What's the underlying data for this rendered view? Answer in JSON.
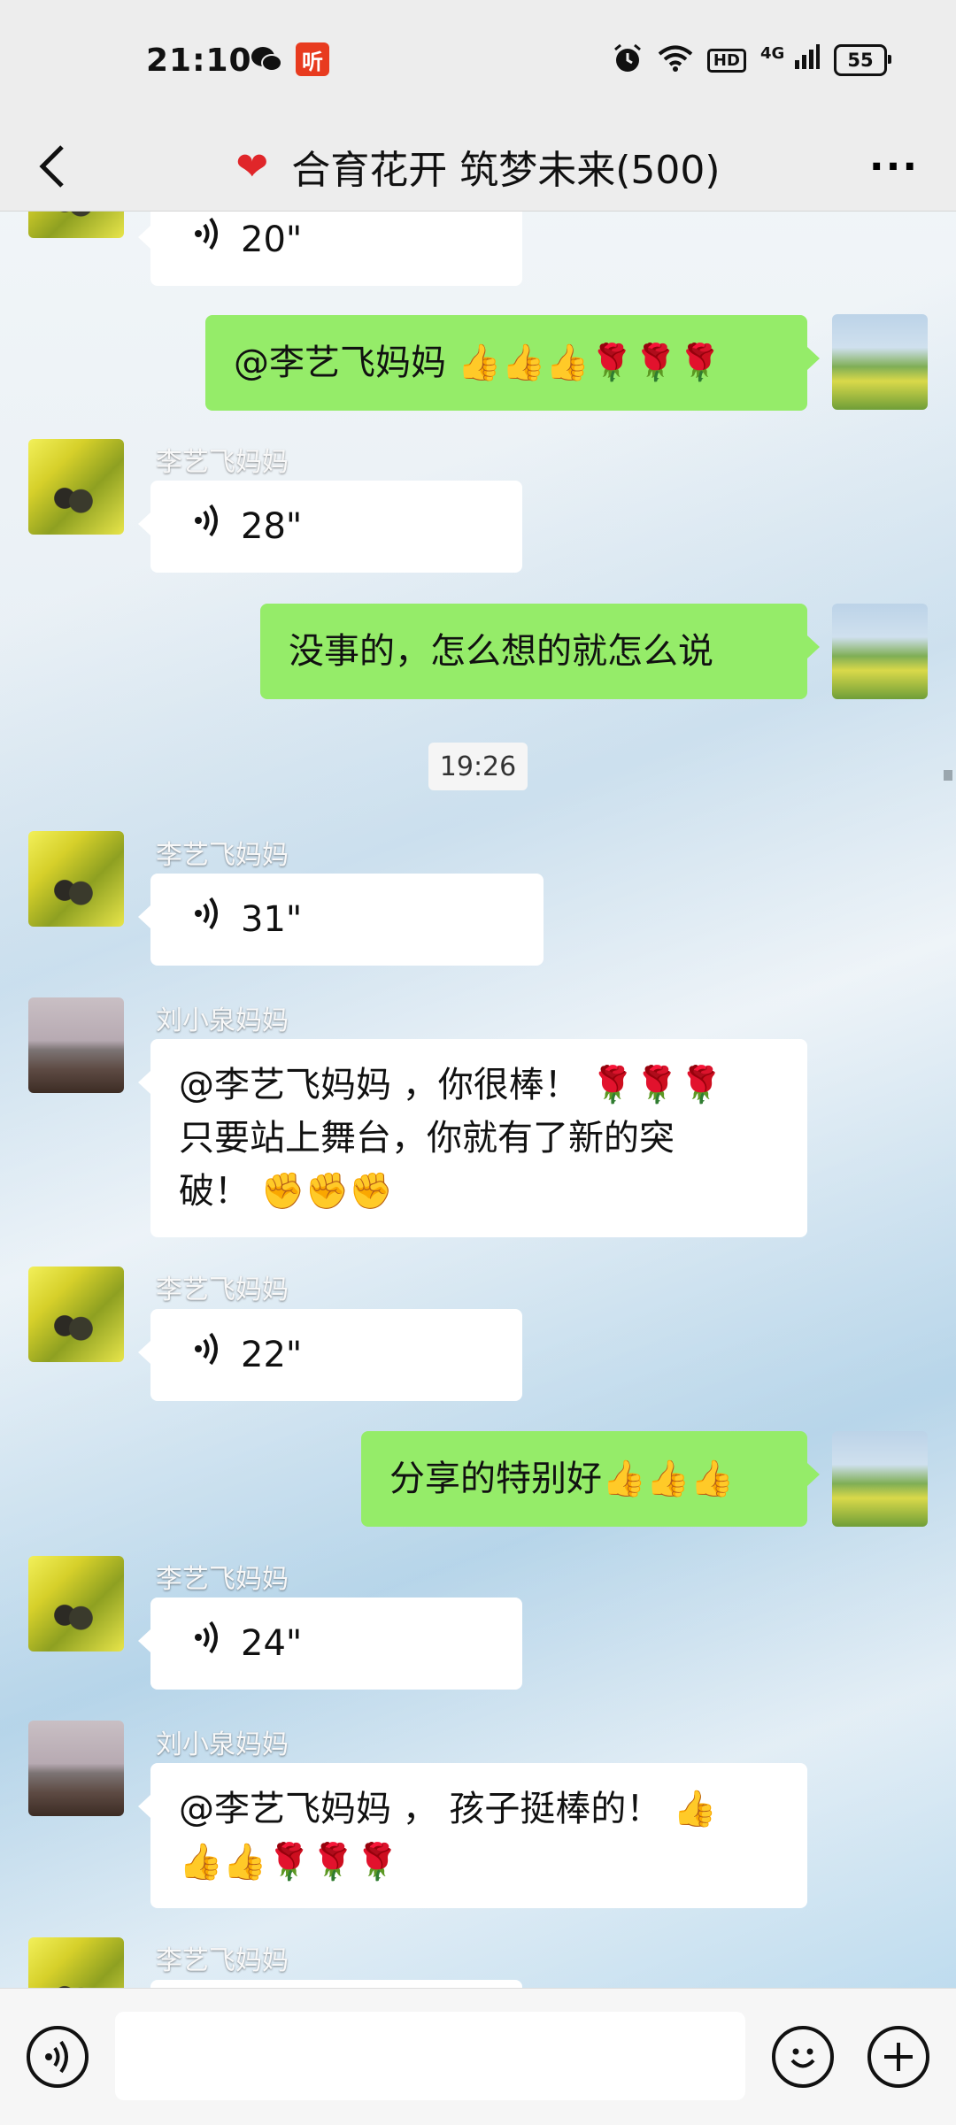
{
  "status_bar": {
    "time": "21:10",
    "left_icons": [
      "wechat-icon",
      "ting-app-icon"
    ],
    "ting_label": "听",
    "signal_label": "4G",
    "hd_label": "HD",
    "battery": "55"
  },
  "header": {
    "title": "合育花开 筑梦未来(500)",
    "heart": "❤",
    "more": "···"
  },
  "messages": [
    {
      "type": "voice",
      "side": "left",
      "sender": "",
      "duration": "20\""
    },
    {
      "type": "text",
      "side": "right",
      "text": "@李艺飞妈妈 👍👍👍🌹🌹🌹"
    },
    {
      "type": "voice",
      "side": "left",
      "sender": "李艺飞妈妈",
      "duration": "28\""
    },
    {
      "type": "text",
      "side": "right",
      "text": "没事的，怎么想的就怎么说"
    },
    {
      "type": "time",
      "text": "19:26"
    },
    {
      "type": "voice",
      "side": "left",
      "sender": "李艺飞妈妈",
      "duration": "31\""
    },
    {
      "type": "text",
      "side": "left",
      "sender": "刘小泉妈妈",
      "lines": [
        "@李艺飞妈妈 ，你很棒！ 🌹🌹🌹",
        "只要站上舞台，你就有了新的突",
        "破！ ✊✊✊"
      ]
    },
    {
      "type": "voice",
      "side": "left",
      "sender": "李艺飞妈妈",
      "duration": "22\""
    },
    {
      "type": "text",
      "side": "right",
      "text": "分享的特别好👍👍👍"
    },
    {
      "type": "voice",
      "side": "left",
      "sender": "李艺飞妈妈",
      "duration": "24\""
    },
    {
      "type": "text",
      "side": "left",
      "sender": "刘小泉妈妈",
      "lines": [
        "@李艺飞妈妈 ， 孩子挺棒的！ 👍",
        "👍👍🌹🌹🌹"
      ]
    },
    {
      "type": "partial",
      "side": "left",
      "sender": "李艺飞妈妈"
    }
  ],
  "input_bar": {
    "voice_toggle_icon": "voice-icon",
    "emoji_icon": "emoji-icon",
    "plus_icon": "plus-icon"
  }
}
